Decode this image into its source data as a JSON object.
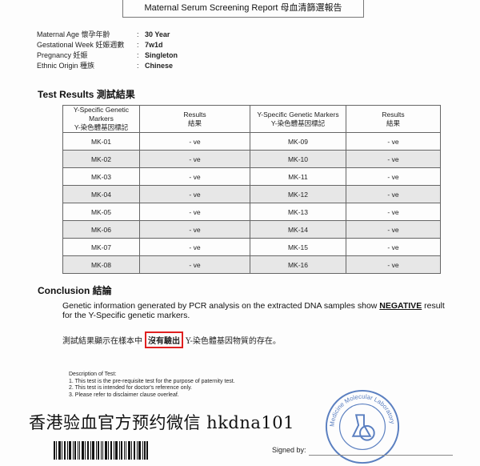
{
  "report": {
    "title": "Maternal Serum Screening Report 母血清篩選報告"
  },
  "patient_info": [
    {
      "label": "Maternal Age 懷孕年齡",
      "value": "30 Year"
    },
    {
      "label": "Gestational Week 妊娠週數",
      "value": "7w1d"
    },
    {
      "label": "Pregnancy 妊娠",
      "value": "Singleton"
    },
    {
      "label": "Ethnic Origin 種族",
      "value": "Chinese"
    }
  ],
  "test_results": {
    "title": "Test Results 測試結果",
    "headers": {
      "marker_en": "Y-Specific Genetic Markers",
      "marker_zh": "Y-染色體基因標記",
      "result_en": "Results",
      "result_zh": "結果"
    },
    "rows": [
      {
        "m1": "MK-01",
        "r1": "- ve",
        "m2": "MK-09",
        "r2": "- ve"
      },
      {
        "m1": "MK-02",
        "r1": "- ve",
        "m2": "MK-10",
        "r2": "- ve"
      },
      {
        "m1": "MK-03",
        "r1": "- ve",
        "m2": "MK-11",
        "r2": "- ve"
      },
      {
        "m1": "MK-04",
        "r1": "- ve",
        "m2": "MK-12",
        "r2": "- ve"
      },
      {
        "m1": "MK-05",
        "r1": "- ve",
        "m2": "MK-13",
        "r2": "- ve"
      },
      {
        "m1": "MK-06",
        "r1": "- ve",
        "m2": "MK-14",
        "r2": "- ve"
      },
      {
        "m1": "MK-07",
        "r1": "- ve",
        "m2": "MK-15",
        "r2": "- ve"
      },
      {
        "m1": "MK-08",
        "r1": "- ve",
        "m2": "MK-16",
        "r2": "- ve"
      }
    ]
  },
  "conclusion": {
    "title": "Conclusion 結論",
    "text_before": "Genetic information generated by PCR analysis on the extracted DNA samples show ",
    "highlight": "NEGATIVE",
    "text_after": " result for the Y-Specific genetic markers.",
    "zh_before": "測試結果顯示在樣本中",
    "zh_highlight": "沒有驗出",
    "zh_after": "Y-染色體基因物質的存在。"
  },
  "description": {
    "title": "Description of Test:",
    "items": [
      "1. This test is the pre-requisite test for the purpose of paternity test.",
      "2. This test is intended for doctor's reference only.",
      "3. Please refer to disclaimer clause overleaf."
    ]
  },
  "watermark": "香港验血官方预约微信 hkdna101",
  "seal": {
    "text": "Medicine Molecular Laboratory"
  },
  "signature": {
    "label": "Signed by:"
  },
  "colors": {
    "highlight_box": "#e02020",
    "shaded_row": "#e7e7e7",
    "seal_blue": "#5a7fc0"
  }
}
